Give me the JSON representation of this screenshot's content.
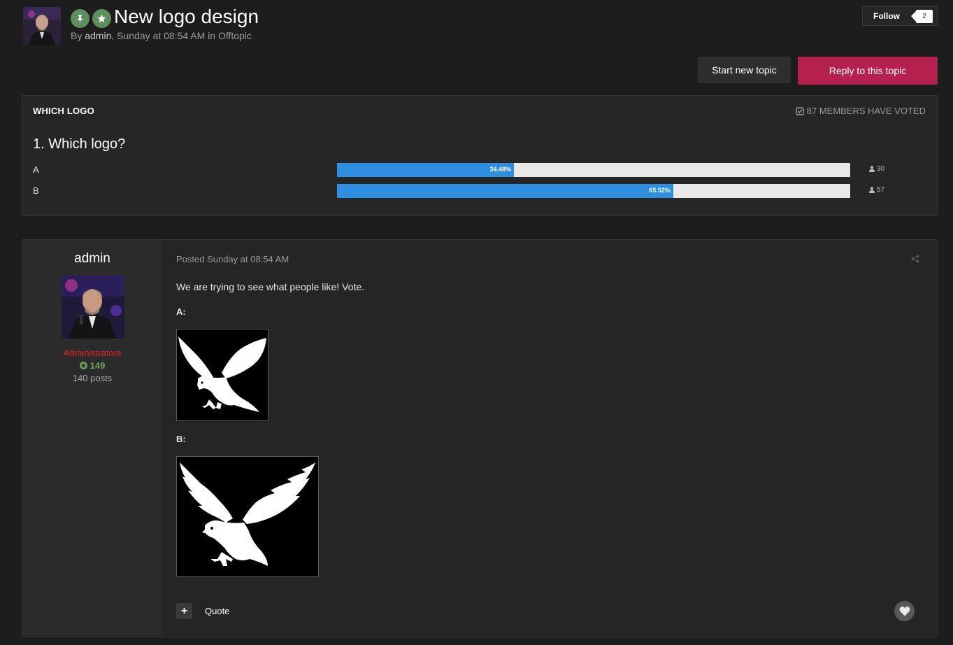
{
  "topic": {
    "title": "New logo design",
    "by_prefix": "By",
    "author": "admin",
    "separator": ",",
    "date": "Sunday at 08:54 AM",
    "in_word": "in",
    "category": "Offtopic"
  },
  "follow": {
    "label": "Follow",
    "count": "2"
  },
  "actions": {
    "start_label": "Start new topic",
    "reply_label": "Reply to this topic"
  },
  "poll": {
    "title": "WHICH LOGO",
    "voted_text": "87 MEMBERS HAVE VOTED",
    "question": "1. Which logo?",
    "options": [
      {
        "label": "A",
        "percent_text": "34.48%",
        "percent": 34.48,
        "votes": "30"
      },
      {
        "label": "B",
        "percent_text": "65.52%",
        "percent": 65.52,
        "votes": "57"
      }
    ],
    "bar_color": "#2e8fe0"
  },
  "post": {
    "username": "admin",
    "group": "Administrators",
    "reputation": "149",
    "post_count": "140 posts",
    "posted": "Posted Sunday at 08:54 AM",
    "message": "We are trying to see what people like! Vote.",
    "label_a": "A:",
    "label_b": "B:",
    "quote_label": "Quote",
    "plus_label": "+"
  },
  "colors": {
    "accent": "#b5214f",
    "group": "#e0242a",
    "reputation": "#6aa15a",
    "badge": "#5b8f5b"
  },
  "icons": [
    "pin-icon",
    "star-icon",
    "check-square-icon",
    "user-icon",
    "plus-circle-icon",
    "share-icon",
    "heart-icon"
  ]
}
